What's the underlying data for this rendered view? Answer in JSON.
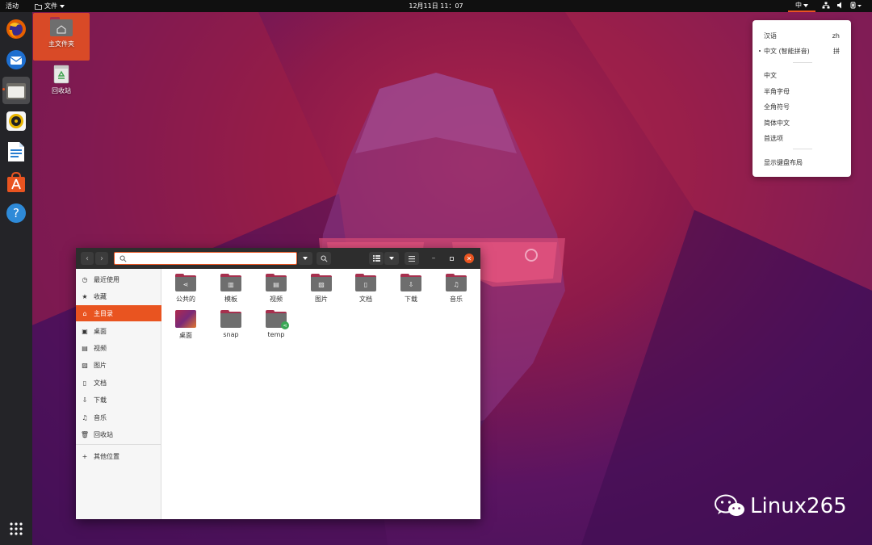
{
  "topbar": {
    "activities": "活动",
    "app_menu": "文件",
    "clock": "12月11日  11：07",
    "ime_indicator": "中"
  },
  "dock": {
    "items": [
      {
        "icon": "firefox-icon"
      },
      {
        "icon": "thunderbird-icon"
      },
      {
        "icon": "files-icon"
      },
      {
        "icon": "rhythmbox-icon"
      },
      {
        "icon": "writer-icon"
      },
      {
        "icon": "software-icon"
      },
      {
        "icon": "help-icon"
      }
    ],
    "show_apps_icon": "app-grid-icon"
  },
  "desktop_icons": [
    {
      "label": "主文件夹",
      "icon": "home-folder-icon"
    },
    {
      "label": "回收站",
      "icon": "trash-icon"
    }
  ],
  "ime_menu": {
    "items": [
      {
        "label": "汉语",
        "hint": "zh"
      },
      {
        "label": "中文 (智能拼音)",
        "hint": "拼"
      },
      {
        "label": "中文",
        "hint": ""
      },
      {
        "label": "半角字母",
        "hint": ""
      },
      {
        "label": "全角符号",
        "hint": ""
      },
      {
        "label": "简体中文",
        "hint": ""
      },
      {
        "label": "首选项",
        "hint": ""
      },
      {
        "label": "显示键盘布局",
        "hint": ""
      }
    ]
  },
  "file_manager": {
    "search_placeholder": "",
    "sidebar": [
      {
        "label": "最近使用",
        "icon": "clock-icon"
      },
      {
        "label": "收藏",
        "icon": "star-icon"
      },
      {
        "label": "主目录",
        "icon": "home-icon"
      },
      {
        "label": "桌面",
        "icon": "desktop-icon"
      },
      {
        "label": "视频",
        "icon": "video-icon"
      },
      {
        "label": "图片",
        "icon": "picture-icon"
      },
      {
        "label": "文档",
        "icon": "document-icon"
      },
      {
        "label": "下载",
        "icon": "download-icon"
      },
      {
        "label": "音乐",
        "icon": "music-icon"
      },
      {
        "label": "回收站",
        "icon": "trash-icon"
      },
      {
        "label": "其他位置",
        "icon": "plus-icon"
      }
    ],
    "active_sidebar": "主目录",
    "folders": [
      {
        "label": "公共的",
        "icon": "share-icon"
      },
      {
        "label": "模板",
        "icon": "template-icon"
      },
      {
        "label": "视频",
        "icon": "video-icon"
      },
      {
        "label": "图片",
        "icon": "picture-icon"
      },
      {
        "label": "文档",
        "icon": "document-icon"
      },
      {
        "label": "下载",
        "icon": "download-icon"
      },
      {
        "label": "音乐",
        "icon": "music-icon"
      },
      {
        "label": "桌面",
        "icon": "desktop-icon"
      },
      {
        "label": "snap",
        "icon": "folder-icon"
      },
      {
        "label": "temp",
        "icon": "shared-folder-icon"
      }
    ]
  },
  "watermark": "Linux265",
  "colors": {
    "accent": "#e95420",
    "panel": "#101010",
    "dock": "#242428"
  }
}
